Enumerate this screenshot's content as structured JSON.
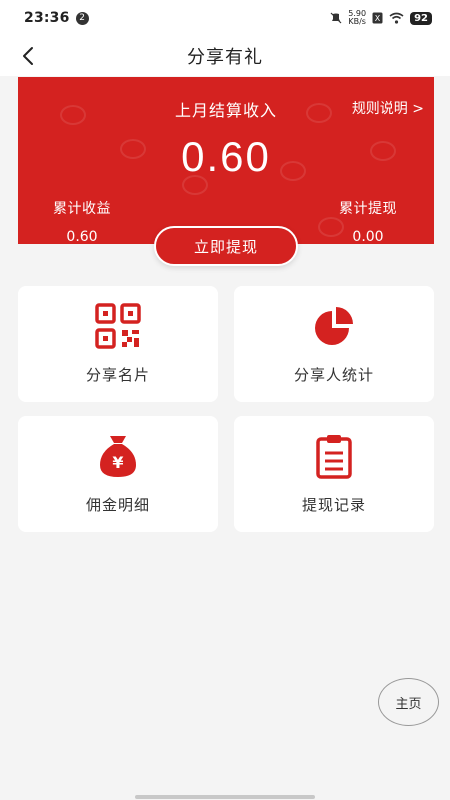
{
  "status_bar": {
    "time": "23:36",
    "notification_count": "2",
    "net_speed_value": "5.90",
    "net_speed_unit": "KB/s",
    "battery": "92"
  },
  "nav": {
    "title": "分享有礼"
  },
  "earnings": {
    "last_month_label": "上月结算收入",
    "rules_link": "规则说明 >",
    "last_month_amount": "0.60",
    "total_income_label": "累计收益",
    "total_income_value": "0.60",
    "total_withdrawn_label": "累计提现",
    "total_withdrawn_value": "0.00",
    "withdraw_button": "立即提现"
  },
  "menu": [
    {
      "label": "分享名片",
      "icon": "qr-code-icon"
    },
    {
      "label": "分享人统计",
      "icon": "pie-chart-icon"
    },
    {
      "label": "佣金明细",
      "icon": "money-bag-icon"
    },
    {
      "label": "提现记录",
      "icon": "clipboard-icon"
    }
  ],
  "floating": {
    "home_label": "主页"
  },
  "colors": {
    "accent": "#d42220",
    "background": "#f4f4f4"
  }
}
